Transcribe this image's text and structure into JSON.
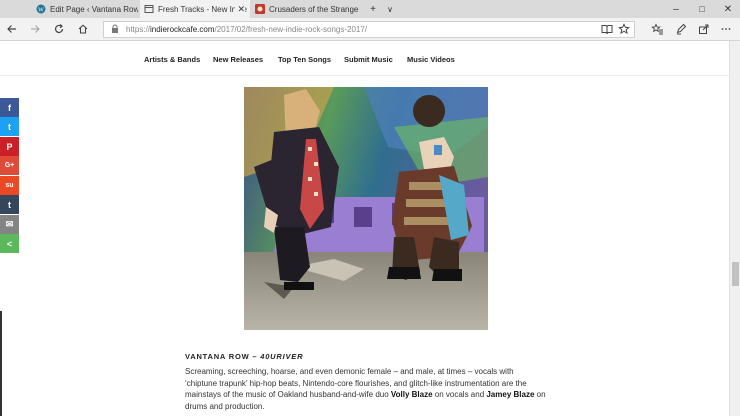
{
  "browser": {
    "tabs": [
      {
        "title": "Edit Page ‹ Vantana Row —"
      },
      {
        "title": "Fresh Tracks - New Indie"
      },
      {
        "title": "Crusaders of the Strange - A"
      }
    ],
    "new_tab_label": "+",
    "tab_list_label": "∨",
    "window_controls": {
      "minimize": "–",
      "maximize": "□",
      "close": "✕"
    },
    "url_scheme": "https://",
    "url_host": "indierockcafe.com",
    "url_path": "/2017/02/fresh-new-indie-rock-songs-2017/",
    "icons": [
      "back-icon",
      "forward-icon",
      "refresh-icon",
      "home-icon",
      "lock-icon",
      "reading-view-icon",
      "favorite-star-icon",
      "favorites-hub-icon",
      "pen-icon",
      "share-icon",
      "more-icon"
    ],
    "colors": {
      "active_tab": "#f2f2f2",
      "tab_strip": "#dadada"
    }
  },
  "site_nav": {
    "items": [
      "Artists & Bands",
      "New Releases",
      "Top Ten Songs",
      "Submit Music",
      "Music Videos"
    ]
  },
  "share_bar": [
    {
      "name": "facebook",
      "glyph": "f",
      "color": "#3b5998"
    },
    {
      "name": "twitter",
      "glyph": "t",
      "color": "#1da1f2"
    },
    {
      "name": "pinterest",
      "glyph": "P",
      "color": "#cb2027"
    },
    {
      "name": "google-plus",
      "glyph": "G+",
      "color": "#dd4b39"
    },
    {
      "name": "stumbleupon",
      "glyph": "su",
      "color": "#eb4924"
    },
    {
      "name": "tumblr",
      "glyph": "t",
      "color": "#35465c"
    },
    {
      "name": "email",
      "glyph": "✉",
      "color": "#848484"
    },
    {
      "name": "more-options",
      "glyph": "<",
      "color": "#5cb85c"
    }
  ],
  "article": {
    "heading_artist": "VANTANA ROW – ",
    "heading_song": "40URIVER",
    "body_part1": "Screaming, screeching, hoarse, and even demonic female – and male, at times – vocals with ‘chiptune trapunk’ hip-hop beats, Nintendo-core flourishes, and glitch-like instrumentation are the mainstays of the music of Oakland husband-and-wife duo ",
    "body_name1": "Volly Blaze",
    "body_part2": " on vocals and ",
    "body_name2": "Jamey Blaze",
    "body_part3": " on drums and production."
  }
}
